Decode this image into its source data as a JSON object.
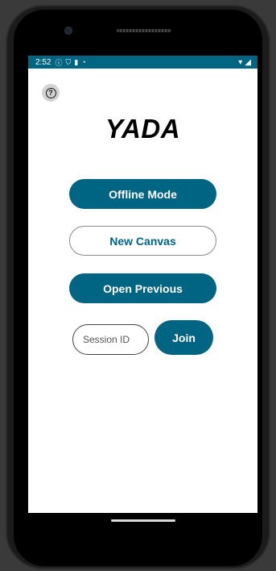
{
  "status_bar": {
    "time": "2:52",
    "icons": [
      "info-icon",
      "shield-icon",
      "sd-card-icon",
      "sync-icon"
    ],
    "right_icons": [
      "wifi-icon",
      "signal-icon"
    ]
  },
  "help": {
    "icon": "help-icon",
    "glyph": "?"
  },
  "app": {
    "title": "YADA"
  },
  "buttons": {
    "offline_mode": "Offline Mode",
    "new_canvas": "New Canvas",
    "open_previous": "Open Previous",
    "join": "Join"
  },
  "session": {
    "placeholder": "Session ID",
    "value": ""
  },
  "colors": {
    "accent": "#006583",
    "status_bar": "#006583"
  }
}
